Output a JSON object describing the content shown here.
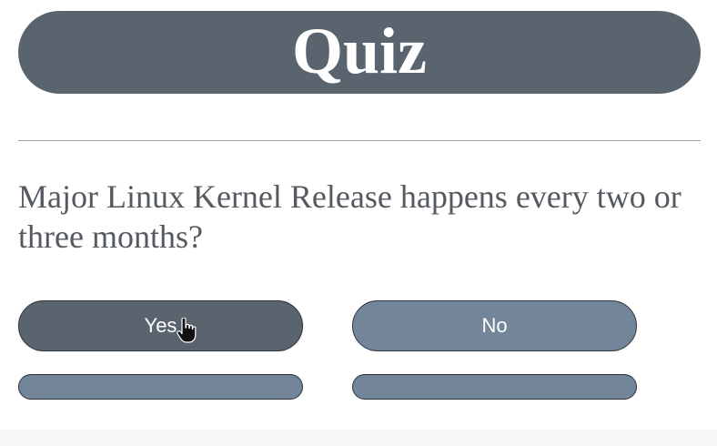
{
  "header": {
    "title": "Quiz"
  },
  "question": {
    "text": "Major Linux Kernel Release happens every two or three months?"
  },
  "answers": [
    {
      "label": "Yes",
      "state": "hovered"
    },
    {
      "label": "No",
      "state": "default"
    }
  ],
  "icons": {
    "cursor": "hand-pointer-icon"
  },
  "colors": {
    "title_bg": "#59646f",
    "button_active": "#59646f",
    "button_default": "#738598",
    "question_text": "#555a60",
    "divider": "#a0a0a0"
  }
}
